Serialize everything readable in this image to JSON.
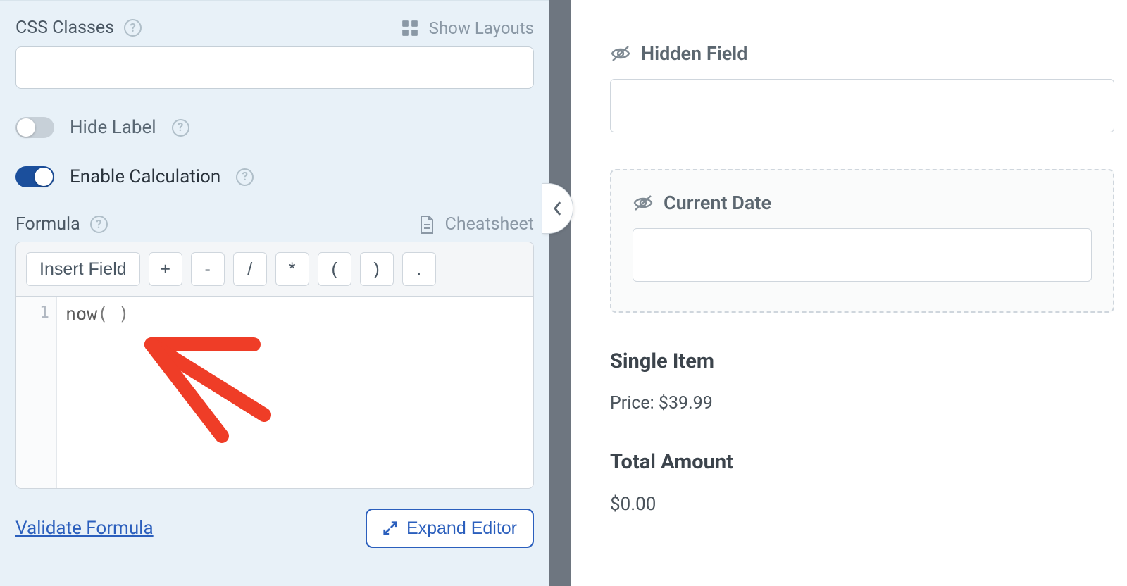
{
  "left": {
    "css_label": "CSS Classes",
    "show_layouts": "Show Layouts",
    "css_value": "",
    "hide_label": "Hide Label",
    "enable_calc": "Enable Calculation",
    "formula_label": "Formula",
    "cheatsheet": "Cheatsheet",
    "toolbar": {
      "insert": "Insert Field",
      "plus": "+",
      "minus": "-",
      "slash": "/",
      "star": "*",
      "lparen": "(",
      "rparen": ")",
      "dot": "."
    },
    "code": {
      "line_no": "1",
      "fn": "now",
      "inner": "( )"
    },
    "validate": "Validate Formula",
    "expand": "Expand Editor"
  },
  "right": {
    "hidden_field": "Hidden Field",
    "current_date": "Current Date",
    "single_item": "Single Item",
    "price_label": "Price: ",
    "price_value": "$39.99",
    "total_label": "Total Amount",
    "total_value": "$0.00"
  }
}
